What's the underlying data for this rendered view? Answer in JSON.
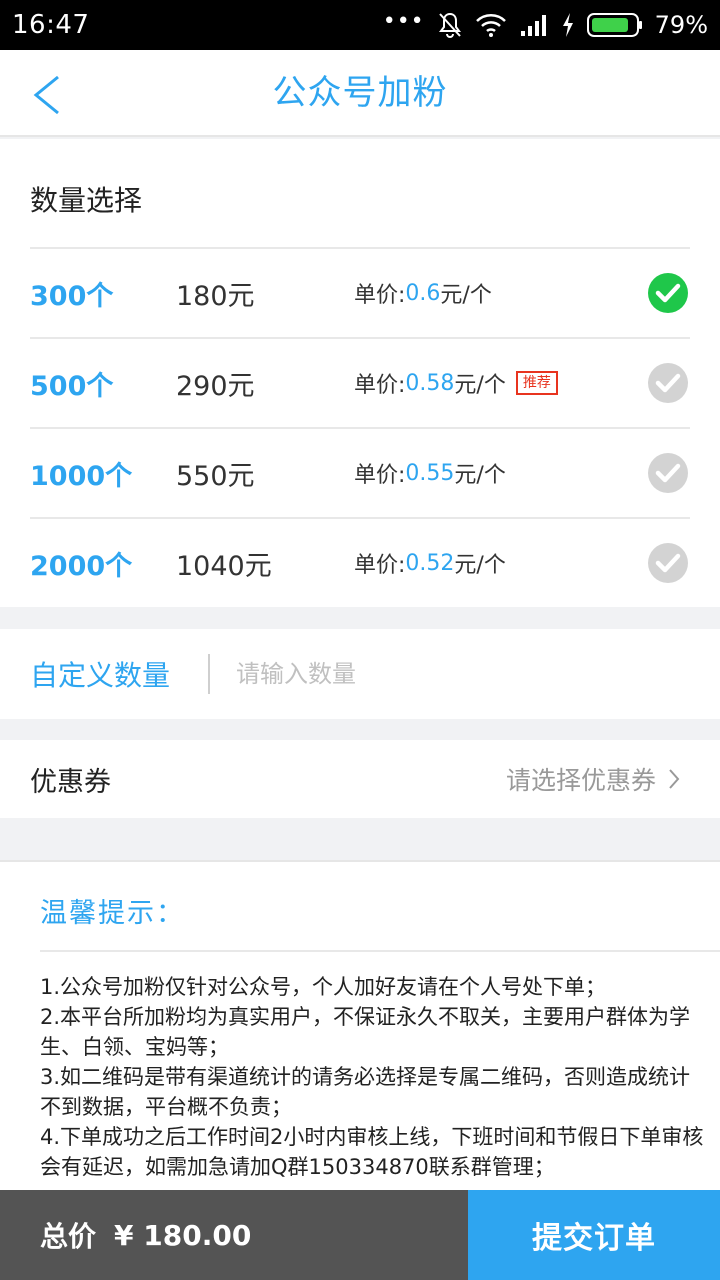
{
  "status_bar": {
    "time": "16:47",
    "dots": "•••",
    "battery_pct": "79%",
    "icons": [
      "mute-bell-icon",
      "wifi-icon",
      "signal-icon",
      "charging-icon",
      "battery-icon"
    ]
  },
  "header": {
    "title": "公众号加粉",
    "back_icon": "chevron-left-icon"
  },
  "quantity": {
    "title": "数量选择",
    "unit_prefix": "单价:",
    "unit_suffix": "元/个",
    "options": [
      {
        "count": "300个",
        "price": "180元",
        "unit_value": "0.6",
        "selected": true,
        "tag": ""
      },
      {
        "count": "500个",
        "price": "290元",
        "unit_value": "0.58",
        "selected": false,
        "tag": "推荐"
      },
      {
        "count": "1000个",
        "price": "550元",
        "unit_value": "0.55",
        "selected": false,
        "tag": ""
      },
      {
        "count": "2000个",
        "price": "1040元",
        "unit_value": "0.52",
        "selected": false,
        "tag": ""
      }
    ]
  },
  "custom": {
    "label": "自定义数量",
    "placeholder": "请输入数量",
    "value": ""
  },
  "coupon": {
    "label": "优惠券",
    "select_text": "请选择优惠券"
  },
  "tips": {
    "title": "温馨提示：",
    "lines": [
      "1.公众号加粉仅针对公众号，个人加好友请在个人号处下单；",
      "2.本平台所加粉均为真实用户，不保证永久不取关，主要用户群体为学生、白领、宝妈等；",
      "3.如二维码是带有渠道统计的请务必选择是专属二维码，否则造成统计不到数据，平台概不负责；",
      "4.下单成功之后工作时间2小时内审核上线，下班时间和节假日下单审核会有延迟，如需加急请加Q群150334870联系群管理；"
    ]
  },
  "footer": {
    "total_label": "总价",
    "total_value": "¥ 180.00",
    "submit_label": "提交订单"
  },
  "colors": {
    "accent": "#2ea5f0",
    "selected_check": "#1fc74a",
    "unselected_check": "#d3d3d3",
    "tag_red": "#e8341f",
    "footer_dark": "#545454"
  }
}
